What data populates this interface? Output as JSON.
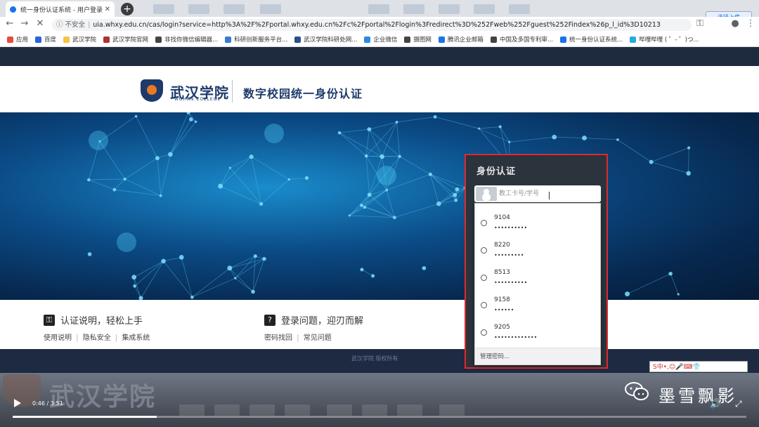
{
  "browser": {
    "tab_title": "统一身份认证系统 - 用户登录",
    "new_tab": "+",
    "upload_badge": "选择上传",
    "insecure_label": "不安全",
    "url": "uia.whxy.edu.cn/cas/login?service=http%3A%2F%2Fportal.whxy.edu.cn%2Fc%2Fportal%2Flogin%3Fredirect%3D%252Fweb%252Fguest%252Findex%26p_l_id%3D10213",
    "bookmarks": [
      {
        "label": "应用",
        "color": "#e84a3c"
      },
      {
        "label": "百度",
        "color": "#2b63d8"
      },
      {
        "label": "武汉学院",
        "color": "#f4c542"
      },
      {
        "label": "武汉学院官网",
        "color": "#a33"
      },
      {
        "label": "非找你微信编辑器...",
        "color": "#444"
      },
      {
        "label": "科研创新服务平台...",
        "color": "#3a7bd5"
      },
      {
        "label": "武汉学院科研处网...",
        "color": "#2b4f8f"
      },
      {
        "label": "企业微信",
        "color": "#2b8be0"
      },
      {
        "label": "摄图网",
        "color": "#444"
      },
      {
        "label": "腾讯企业邮箱",
        "color": "#1a73e8"
      },
      {
        "label": "中国及多国专利审...",
        "color": "#444"
      },
      {
        "label": "统一身份认证系统...",
        "color": "#1a73e8"
      },
      {
        "label": "哔哩哔哩 ( ゜- ゜)つ...",
        "color": "#23ade5"
      }
    ]
  },
  "header": {
    "brand": "武汉学院",
    "brand_en": "WUHAN COLLEGE",
    "subtitle": "数字校园统一身份认证"
  },
  "login": {
    "title": "身份认证",
    "username_placeholder": "教工卡号/学号",
    "accounts": [
      {
        "id": "9104",
        "mask": "••••••••••"
      },
      {
        "id": "8220",
        "mask": "•••••••••"
      },
      {
        "id": "8513",
        "mask": "••••••••••"
      },
      {
        "id": "9158",
        "mask": "••••••"
      },
      {
        "id": "9205",
        "mask": "•••••••••••••"
      }
    ],
    "manage_label": "管理密码..."
  },
  "footer": {
    "auth_heading": "认证说明，轻松上手",
    "auth_links": [
      "使用说明",
      "隐私安全",
      "集成系统"
    ],
    "login_heading": "登录问题，迎刃而解",
    "login_links": [
      "密码找回",
      "常见问题"
    ],
    "copyright": "武汉学院 版权所有"
  },
  "ime_bar": "S中•,☺🎤⌨👕",
  "video": {
    "watermark": "武汉学院",
    "channel": "墨雪飘影",
    "time": "0:46 / 3:51",
    "progress": 0.196
  }
}
